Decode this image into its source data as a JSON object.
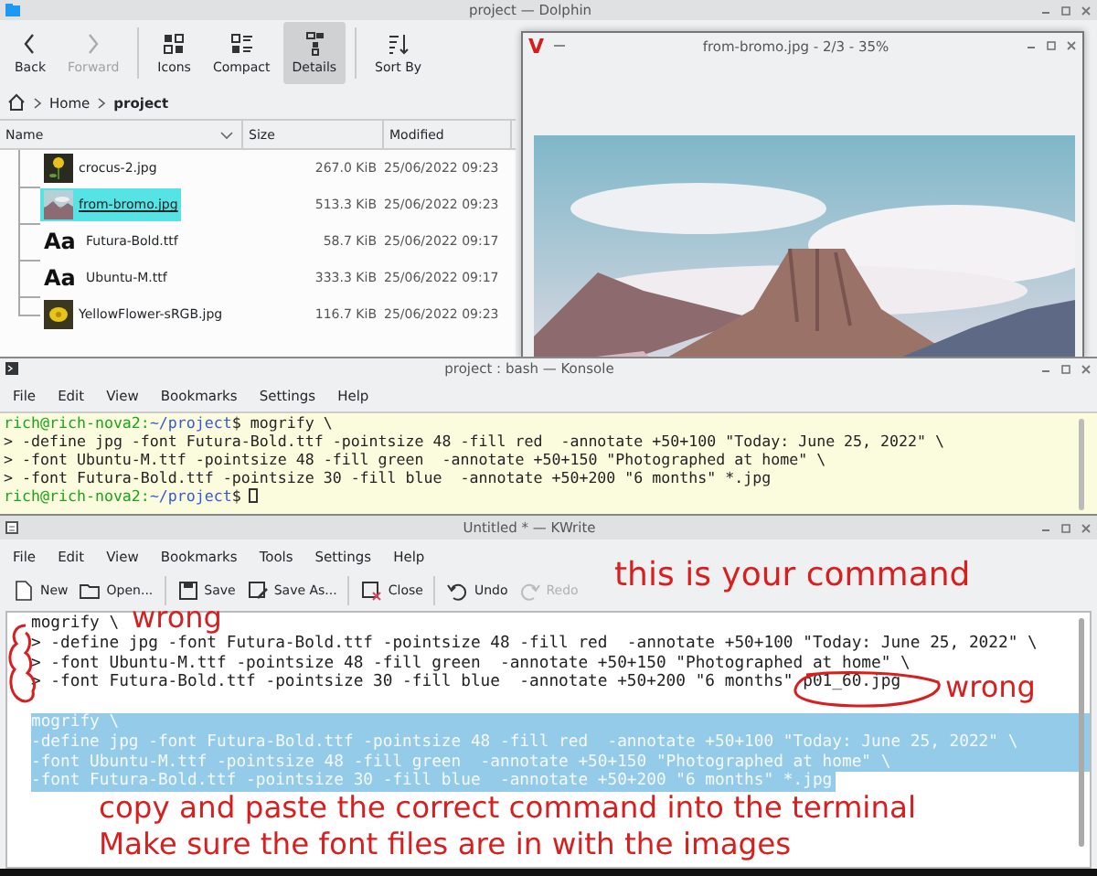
{
  "dolphin": {
    "title": "project — Dolphin",
    "toolbar": [
      [
        {
          "kind": "back",
          "label": "Back",
          "selected": false,
          "disabled": false
        },
        {
          "kind": "forward",
          "label": "Forward",
          "selected": false,
          "disabled": true
        }
      ],
      [
        {
          "kind": "icons",
          "label": "Icons",
          "selected": false,
          "disabled": false
        },
        {
          "kind": "compact",
          "label": "Compact",
          "selected": false,
          "disabled": false
        },
        {
          "kind": "details",
          "label": "Details",
          "selected": true,
          "disabled": false
        }
      ],
      [
        {
          "kind": "sort",
          "label": "Sort By",
          "selected": false,
          "disabled": false
        }
      ]
    ],
    "breadcrumb": [
      {
        "label": "Home",
        "current": false
      },
      {
        "label": "project",
        "current": true
      }
    ],
    "columns": [
      "Name",
      "Size",
      "Modified"
    ],
    "files": [
      {
        "name": "crocus-2.jpg",
        "size": "267.0 KiB",
        "modified": "25/06/2022 09:23",
        "selected": false
      },
      {
        "name": "from-bromo.jpg",
        "size": "513.3 KiB",
        "modified": "25/06/2022 09:23",
        "selected": true
      },
      {
        "kind": "font",
        "glyph": "Aa",
        "name": "Futura-Bold.ttf",
        "size": "58.7 KiB",
        "modified": "25/06/2022 09:17",
        "selected": false
      },
      {
        "kind": "font",
        "glyph": "Aa",
        "name": "Ubuntu-M.ttf",
        "size": "333.3 KiB",
        "modified": "25/06/2022 09:17",
        "selected": false
      },
      {
        "name": "YellowFlower-sRGB.jpg",
        "size": "116.7 KiB",
        "modified": "25/06/2022 09:23",
        "selected": false
      }
    ]
  },
  "viewer": {
    "logo": "V",
    "title": "from-bromo.jpg - 2/3 - 35%"
  },
  "konsole": {
    "title": "project : bash — Konsole",
    "menu": [
      "File",
      "Edit",
      "View",
      "Bookmarks",
      "Settings",
      "Help"
    ],
    "lines": [
      {
        "kind": "prompt",
        "user": "rich@rich-nova2:",
        "path": "~/project",
        "command": "$ mogrify \\",
        "cursor": false
      },
      {
        "kind": "text",
        "text": "> -define jpg -font Futura-Bold.ttf -pointsize 48 -fill red  -annotate +50+100 \"Today: June 25, 2022\" \\"
      },
      {
        "kind": "text",
        "text": "> -font Ubuntu-M.ttf -pointsize 48 -fill green  -annotate +50+150 \"Photographed at home\" \\"
      },
      {
        "kind": "text",
        "text": "> -font Futura-Bold.ttf -pointsize 30 -fill blue  -annotate +50+200 \"6 months\" *.jpg"
      },
      {
        "kind": "prompt",
        "user": "rich@rich-nova2:",
        "path": "~/project",
        "command": "$",
        "cursor": true
      }
    ]
  },
  "kwrite": {
    "title": "Untitled * — KWrite",
    "menu": [
      "File",
      "Edit",
      "View",
      "Bookmarks",
      "Tools",
      "Settings",
      "Help"
    ],
    "toolbar": [
      [
        {
          "kind": "new",
          "label": "New",
          "disabled": false
        },
        {
          "kind": "open",
          "label": "Open...",
          "disabled": false
        }
      ],
      [
        {
          "kind": "save",
          "label": "Save",
          "disabled": false
        },
        {
          "kind": "saveas",
          "label": "Save As...",
          "disabled": false
        }
      ],
      [
        {
          "kind": "close",
          "label": "Close",
          "disabled": false
        }
      ],
      [
        {
          "kind": "undo",
          "label": "Undo",
          "disabled": false
        },
        {
          "kind": "redo",
          "label": "Redo",
          "disabled": true
        }
      ]
    ],
    "blocks": [
      [
        {
          "text": "mogrify \\",
          "selected": false
        },
        {
          "text": "> -define jpg -font Futura-Bold.ttf -pointsize 48 -fill red  -annotate +50+100 \"Today: June 25, 2022\" \\",
          "selected": false
        },
        {
          "text": "> -font Ubuntu-M.ttf -pointsize 48 -fill green  -annotate +50+150 \"Photographed at home\" \\",
          "selected": false
        },
        {
          "text": "> -font Futura-Bold.ttf -pointsize 30 -fill blue  -annotate +50+200 \"6 months\" p01_60.jpg",
          "selected": false
        }
      ],
      [
        {
          "text": "mogrify \\",
          "selected": true
        },
        {
          "text": "-define jpg -font Futura-Bold.ttf -pointsize 48 -fill red  -annotate +50+100 \"Today: June 25, 2022\" \\",
          "selected": true
        },
        {
          "text": "-font Ubuntu-M.ttf -pointsize 48 -fill green  -annotate +50+150 \"Photographed at home\" \\",
          "selected": true
        },
        {
          "text": "-font Futura-Bold.ttf -pointsize 30 -fill blue  -annotate +50+200 \"6 months\" *.jpg",
          "selected": true
        }
      ]
    ]
  },
  "annotations": [
    {
      "kind": "note",
      "text": "this is your command"
    },
    {
      "kind": "wrong-left",
      "text": "wrong"
    },
    {
      "kind": "wrong-right",
      "text": "wrong"
    },
    {
      "kind": "instructions",
      "lines": [
        "copy and paste the correct command into the terminal",
        "Make sure the font files are in with the images"
      ]
    }
  ]
}
